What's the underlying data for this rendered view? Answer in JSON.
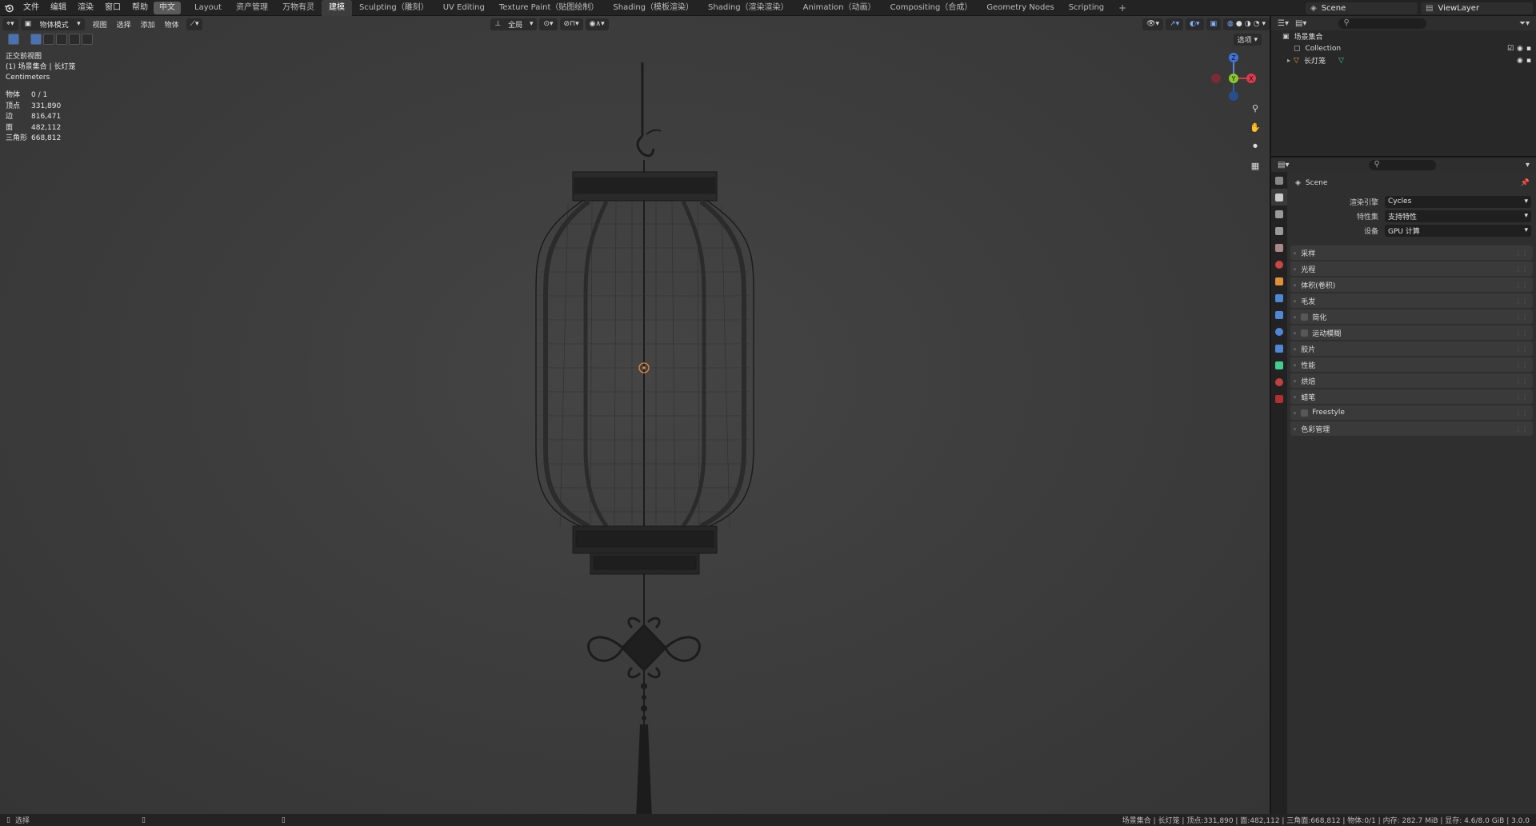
{
  "top_menu": [
    "文件",
    "编辑",
    "渲染",
    "窗口",
    "帮助",
    "中文"
  ],
  "workspace_tabs": [
    "Layout",
    "资产管理",
    "万物有灵",
    "建模",
    "Sculpting（雕刻）",
    "UV Editing",
    "Texture Paint（贴图绘制）",
    "Shading（模板渲染）",
    "Shading（渲染渲染）",
    "Animation（动画）",
    "Compositing（合成）",
    "Geometry Nodes",
    "Scripting"
  ],
  "active_tab": "建模",
  "scene_name": "Scene",
  "view_layer": "ViewLayer",
  "viewport": {
    "mode": "物体模式",
    "menus": [
      "视图",
      "选择",
      "添加",
      "物体"
    ],
    "transform": "全局",
    "options": "选项",
    "view_name": "正交前视图",
    "collection_line": "(1) 场景集合 | 长灯笼",
    "units": "Centimeters",
    "stats": [
      {
        "k": "物体",
        "v": "0 / 1"
      },
      {
        "k": "顶点",
        "v": "331,890"
      },
      {
        "k": "边",
        "v": "816,471"
      },
      {
        "k": "面",
        "v": "482,112"
      },
      {
        "k": "三角形",
        "v": "668,812"
      }
    ],
    "gizmo": {
      "z": "Z",
      "y": "Y",
      "x": "X"
    }
  },
  "outliner": {
    "root": "场景集合",
    "items": [
      "Collection",
      "长灯笼"
    ]
  },
  "properties": {
    "scene_label": "Scene",
    "render_engine_label": "渲染引擎",
    "render_engine": "Cycles",
    "feature_set_label": "特性集",
    "feature_set": "支持特性",
    "device_label": "设备",
    "device": "GPU 计算",
    "panels": [
      {
        "label": "采样",
        "cb": false
      },
      {
        "label": "光程",
        "cb": false
      },
      {
        "label": "体积(卷积)",
        "cb": false
      },
      {
        "label": "毛发",
        "cb": false
      },
      {
        "label": "简化",
        "cb": true
      },
      {
        "label": "运动模糊",
        "cb": true
      },
      {
        "label": "胶片",
        "cb": false
      },
      {
        "label": "性能",
        "cb": false
      },
      {
        "label": "烘焙",
        "cb": false
      },
      {
        "label": "蜡笔",
        "cb": false
      },
      {
        "label": "Freestyle",
        "cb": true
      },
      {
        "label": "色彩管理",
        "cb": false
      }
    ]
  },
  "statusbar": {
    "left": "选择",
    "right": "场景集合 | 长灯笼 | 顶点:331,890 | 面:482,112 | 三角面:668,812 | 物体:0/1 | 内存: 282.7 MiB | 显存: 4.6/8.0 GiB | 3.0.0"
  }
}
